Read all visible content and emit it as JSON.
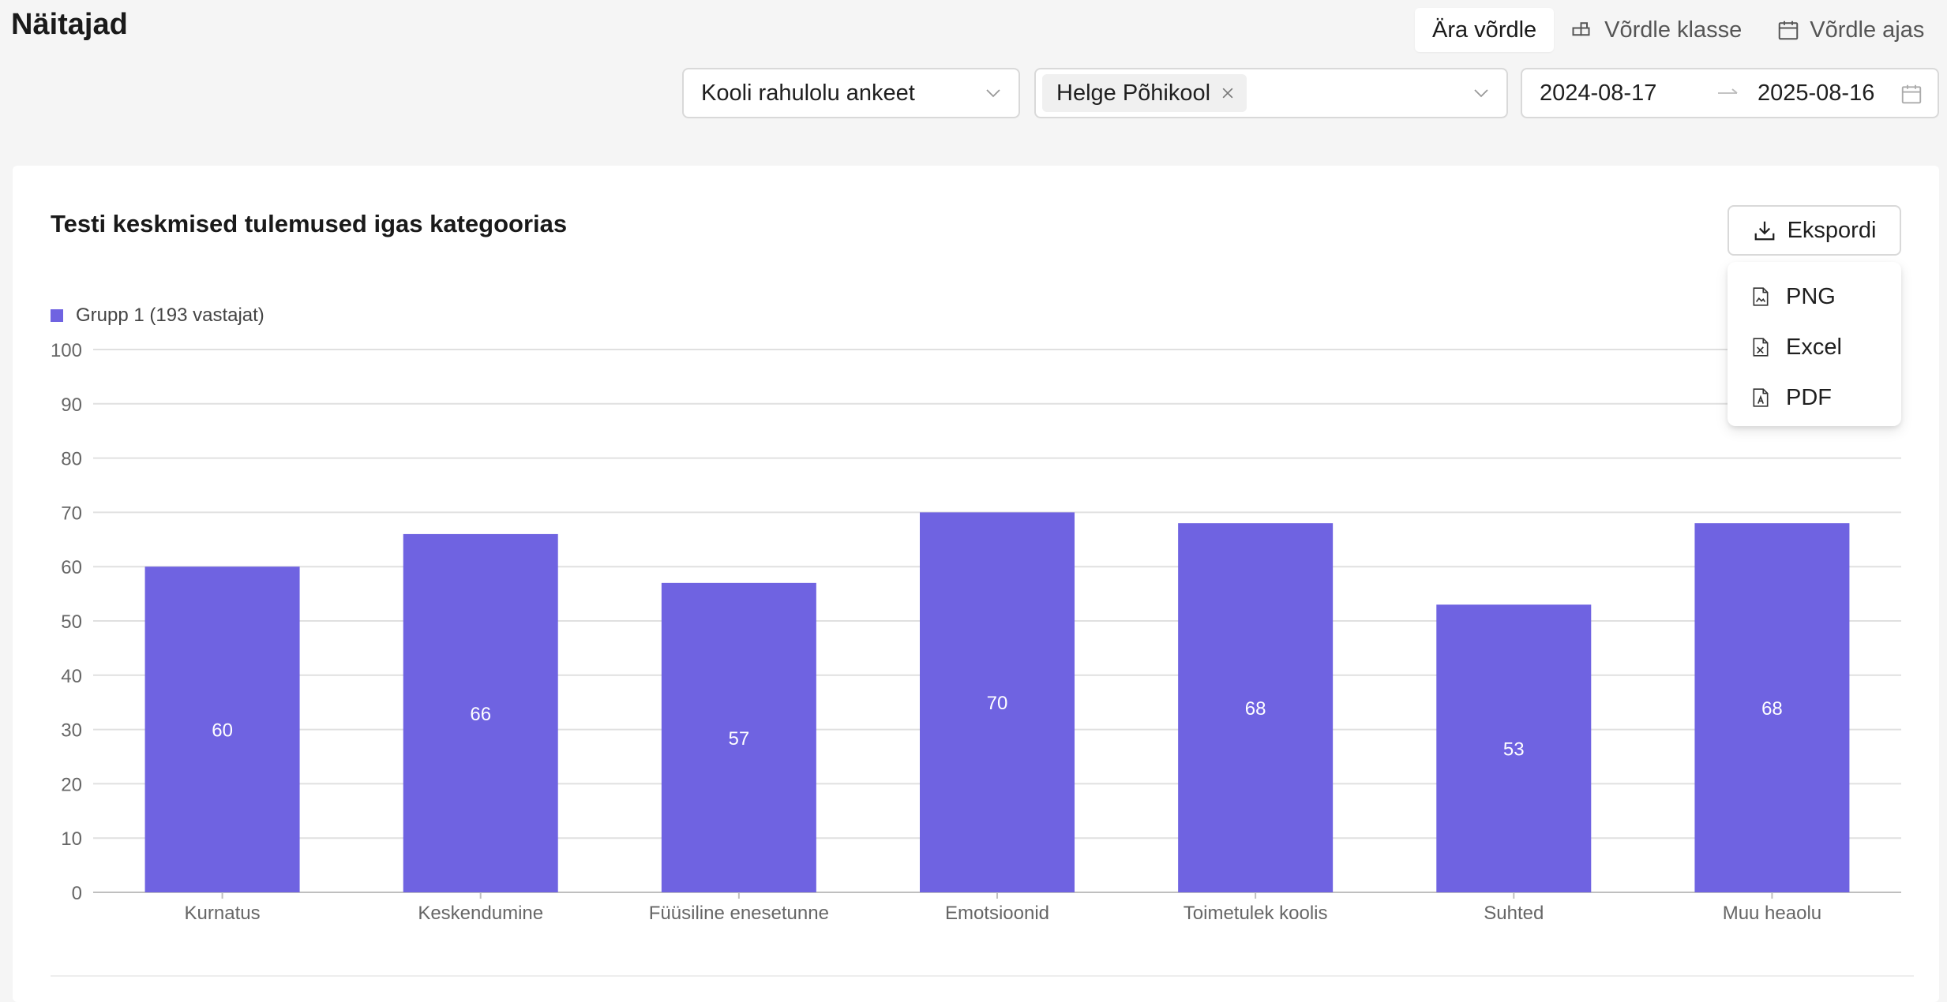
{
  "header": {
    "title": "Näitajad",
    "compare": [
      {
        "label": "Ära võrdle",
        "icon": "",
        "active": true
      },
      {
        "label": "Võrdle klasse",
        "icon": "group-icon",
        "active": false
      },
      {
        "label": "Võrdle ajas",
        "icon": "calendar-icon",
        "active": false
      }
    ]
  },
  "filters": {
    "survey": "Kooli rahulolu ankeet",
    "school_tag": "Helge Põhikool",
    "date_start": "2024-08-17",
    "date_end": "2025-08-16"
  },
  "card": {
    "title": "Testi keskmised tulemused igas kategoorias",
    "export_label": "Ekspordi",
    "export_menu": [
      "PNG",
      "Excel",
      "PDF"
    ]
  },
  "colors": {
    "bar": "#6f63e1",
    "grid": "#e0e0e0",
    "axis": "#bfbfbf",
    "tick": "#666666"
  },
  "chart_data": {
    "type": "bar",
    "categories": [
      "Kurnatus",
      "Keskendumine",
      "Füüsiline enesetunne",
      "Emotsioonid",
      "Toimetulek koolis",
      "Suhted",
      "Muu heaolu"
    ],
    "series": [
      {
        "name": "Grupp 1 (193 vastajat)",
        "values": [
          60,
          66,
          57,
          70,
          68,
          53,
          68
        ]
      }
    ],
    "yticks": [
      0,
      10,
      20,
      30,
      40,
      50,
      60,
      70,
      80,
      90,
      100
    ],
    "ylim": [
      0,
      100
    ],
    "legend": "top-left",
    "grid": true
  }
}
